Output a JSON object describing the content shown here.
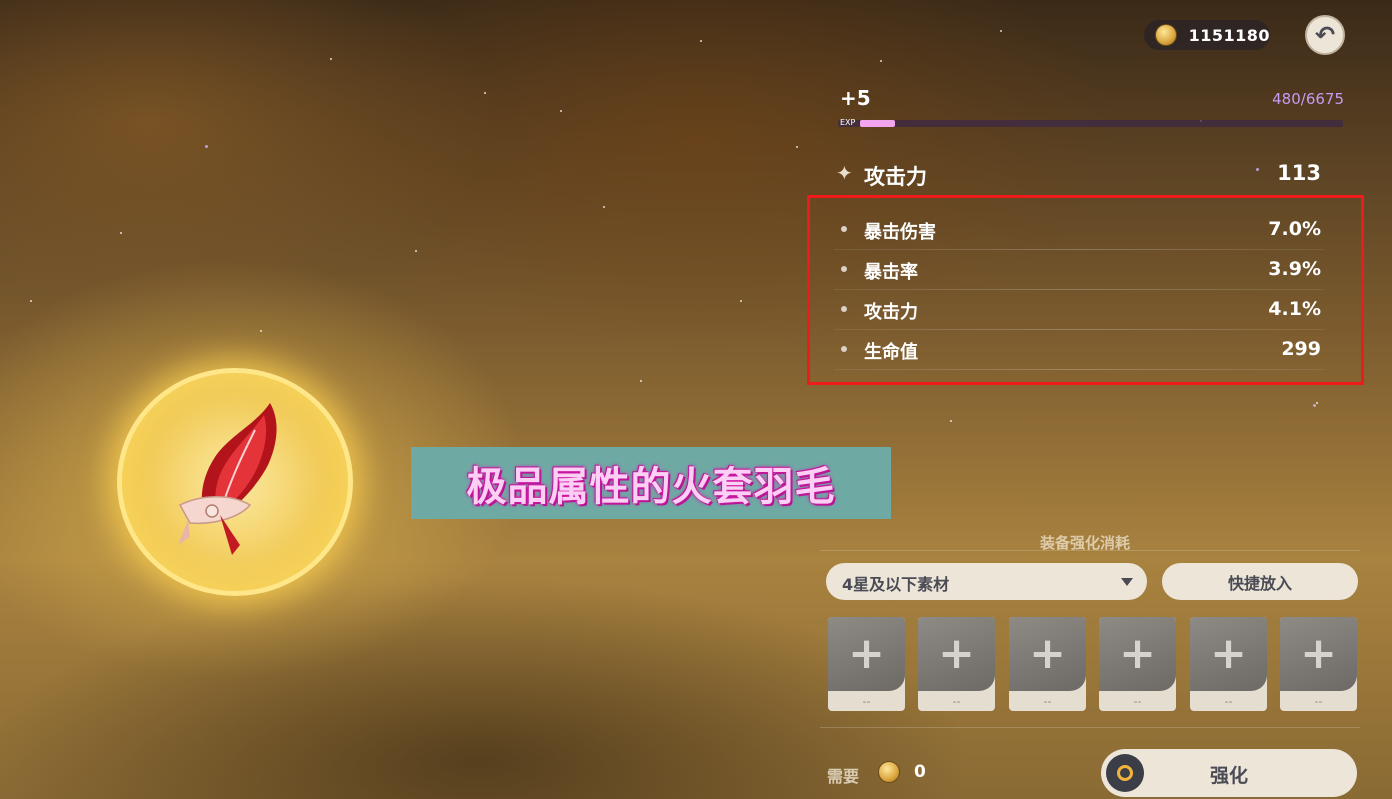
{
  "currency": {
    "icon": "mora-coin-icon",
    "amount": "1151180"
  },
  "back_button": {
    "icon": "back-arrow-icon"
  },
  "artifact": {
    "level": "+5",
    "exp_current": 480,
    "exp_max": 6675,
    "exp_text": "480/6675",
    "exp_label": "EXP",
    "main_stat": {
      "name": "攻击力",
      "value": "113"
    },
    "sub_stats": [
      {
        "name": "暴击伤害",
        "value": "7.0%"
      },
      {
        "name": "暴击率",
        "value": "3.9%"
      },
      {
        "name": "攻击力",
        "value": "4.1%"
      },
      {
        "name": "生命值",
        "value": "299"
      }
    ]
  },
  "caption": {
    "text": "极品属性的火套羽毛"
  },
  "enhance": {
    "title": "装备强化消耗",
    "filter_selected": "4星及以下素材",
    "quick_add_label": "快捷放入",
    "slots": [
      {
        "icon": "plus-icon",
        "label": "--"
      },
      {
        "icon": "plus-icon",
        "label": "--"
      },
      {
        "icon": "plus-icon",
        "label": "--"
      },
      {
        "icon": "plus-icon",
        "label": "--"
      },
      {
        "icon": "plus-icon",
        "label": "--"
      },
      {
        "icon": "plus-icon",
        "label": "--"
      }
    ],
    "cost_label": "需要",
    "cost_value": "0",
    "button_label": "强化"
  },
  "colors": {
    "highlight_border": "#f01a1a",
    "exp_fill": "#f2a4f0",
    "exp_text": "#c59cf2",
    "button_bg": "#ece5d8"
  }
}
